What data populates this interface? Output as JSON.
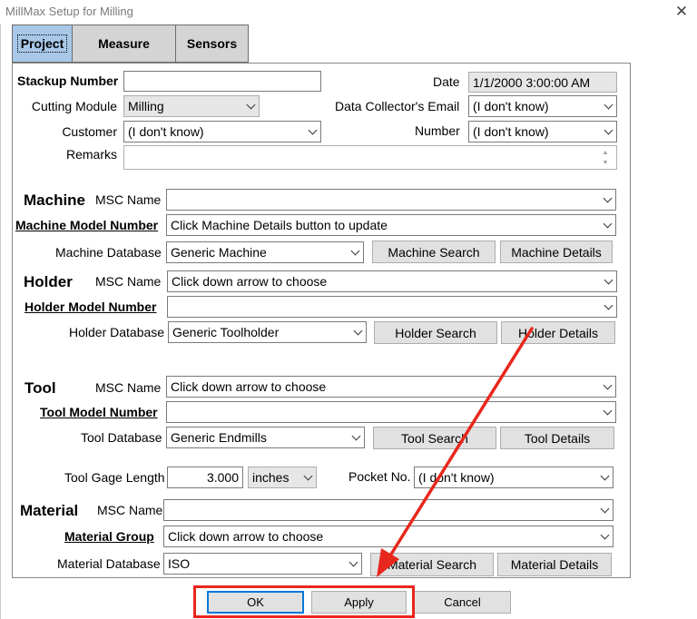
{
  "window": {
    "title": "MillMax Setup for Milling",
    "close": "✕"
  },
  "tabs": [
    {
      "label": "Project",
      "active": true
    },
    {
      "label": "Measure",
      "active": false
    },
    {
      "label": "Sensors",
      "active": false
    }
  ],
  "project": {
    "stackup_label": "Stackup Number",
    "stackup_value": "",
    "date_label": "Date",
    "date_value": "1/1/2000 3:00:00 AM",
    "cutting_module_label": "Cutting Module",
    "cutting_module_value": "Milling",
    "email_label": "Data Collector's Email",
    "email_value": "(I don't know)",
    "customer_label": "Customer",
    "customer_value": "(I don't know)",
    "number_label": "Number",
    "number_value": "(I don't know)",
    "remarks_label": "Remarks",
    "remarks_value": ""
  },
  "machine": {
    "heading": "Machine",
    "msc_label": "MSC Name",
    "msc_value": "",
    "model_label": "Machine Model Number",
    "model_value": "Click Machine Details button to update",
    "db_label": "Machine Database",
    "db_value": "Generic Machine",
    "search_button": "Machine Search",
    "details_button": "Machine Details"
  },
  "holder": {
    "heading": "Holder",
    "msc_label": "MSC Name",
    "msc_value": "Click down arrow to choose",
    "model_label": "Holder Model Number",
    "model_value": "",
    "db_label": "Holder Database",
    "db_value": "Generic Toolholder",
    "search_button": "Holder Search",
    "details_button": "Holder Details"
  },
  "tool": {
    "heading": "Tool",
    "msc_label": "MSC Name",
    "msc_value": "Click down arrow to choose",
    "model_label": "Tool Model Number",
    "model_value": "",
    "db_label": "Tool Database",
    "db_value": "Generic Endmills",
    "search_button": "Tool Search",
    "details_button": "Tool Details",
    "gage_label": "Tool Gage Length",
    "gage_value": "3.000",
    "gage_unit": "inches",
    "pocket_label": "Pocket No.",
    "pocket_value": "(I don't know)"
  },
  "material": {
    "heading": "Material",
    "msc_label": "MSC Name",
    "msc_value": "",
    "group_label": "Material Group",
    "group_value": "Click down arrow to choose",
    "db_label": "Material Database",
    "db_value": "ISO",
    "search_button": "Material Search",
    "details_button": "Material Details"
  },
  "footer": {
    "ok": "OK",
    "apply": "Apply",
    "cancel": "Cancel"
  },
  "annotation_color": "#e8271c"
}
